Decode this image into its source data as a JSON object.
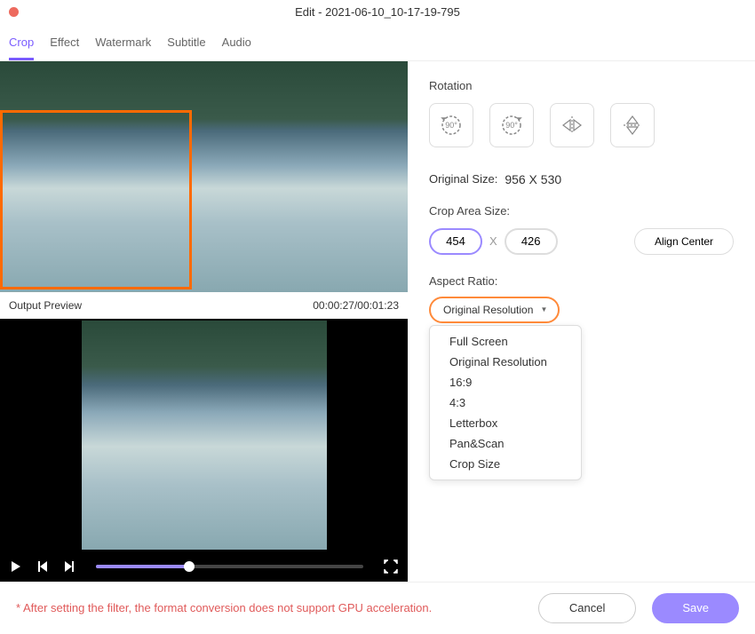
{
  "title": "Edit - 2021-06-10_10-17-19-795",
  "tabs": [
    "Crop",
    "Effect",
    "Watermark",
    "Subtitle",
    "Audio"
  ],
  "activeTab": 0,
  "outputPreviewLabel": "Output Preview",
  "timecode": "00:00:27/00:01:23",
  "right": {
    "rotationLabel": "Rotation",
    "rotateCCW": "90°",
    "rotateCW": "90°",
    "originalSizeLabel": "Original Size:",
    "originalSizeValue": "956 X 530",
    "cropAreaLabel": "Crop Area Size:",
    "width": "454",
    "height": "426",
    "alignCenter": "Align Center",
    "aspectLabel": "Aspect Ratio:",
    "aspectSelected": "Original Resolution",
    "aspectOptions": [
      "Full Screen",
      "Original Resolution",
      "16:9",
      "4:3",
      "Letterbox",
      "Pan&Scan",
      "Crop Size"
    ]
  },
  "footer": {
    "warning": "* After setting the filter, the format conversion does not support GPU acceleration.",
    "cancel": "Cancel",
    "save": "Save"
  }
}
